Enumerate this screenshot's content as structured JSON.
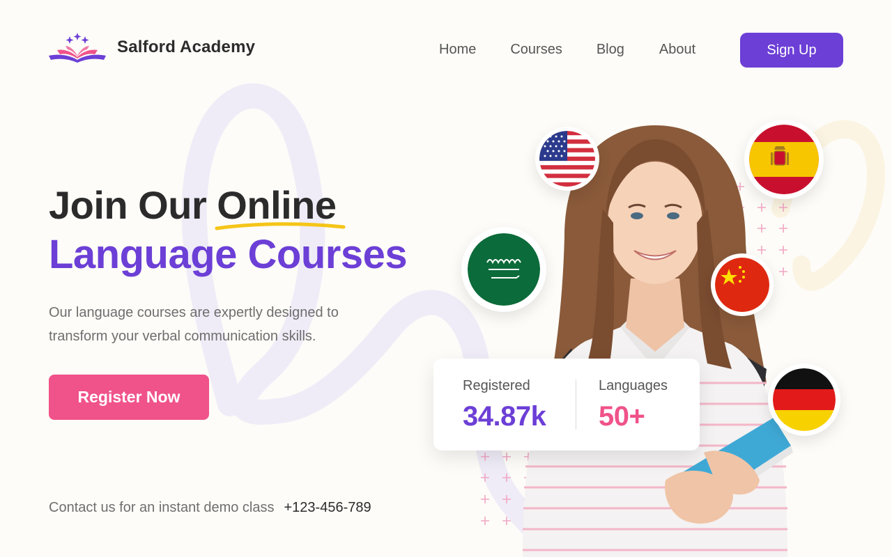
{
  "header": {
    "brand": "Salford Academy",
    "nav": [
      "Home",
      "Courses",
      "Blog",
      "About"
    ],
    "signup_label": "Sign Up"
  },
  "hero": {
    "title_line1_prefix": "Join Our ",
    "title_line1_highlight": "Online",
    "title_line2": "Language Courses",
    "subtitle": "Our language courses are expertly designed to transform your verbal communication skills.",
    "register_label": "Register Now"
  },
  "contact": {
    "text": "Contact us for an instant demo class",
    "phone": "+123-456-789"
  },
  "stats": [
    {
      "label": "Registered",
      "value": "34.87k"
    },
    {
      "label": "Languages",
      "value": "50+"
    }
  ],
  "flags": [
    "usa-flag-icon",
    "spain-flag-icon",
    "saudi-arabia-flag-icon",
    "china-flag-icon",
    "germany-flag-icon"
  ],
  "colors": {
    "primary": "#6c3fd6",
    "accent": "#f0528a",
    "highlight": "#f5c518",
    "background": "#fdfcf8",
    "text": "#2b2b2b"
  }
}
